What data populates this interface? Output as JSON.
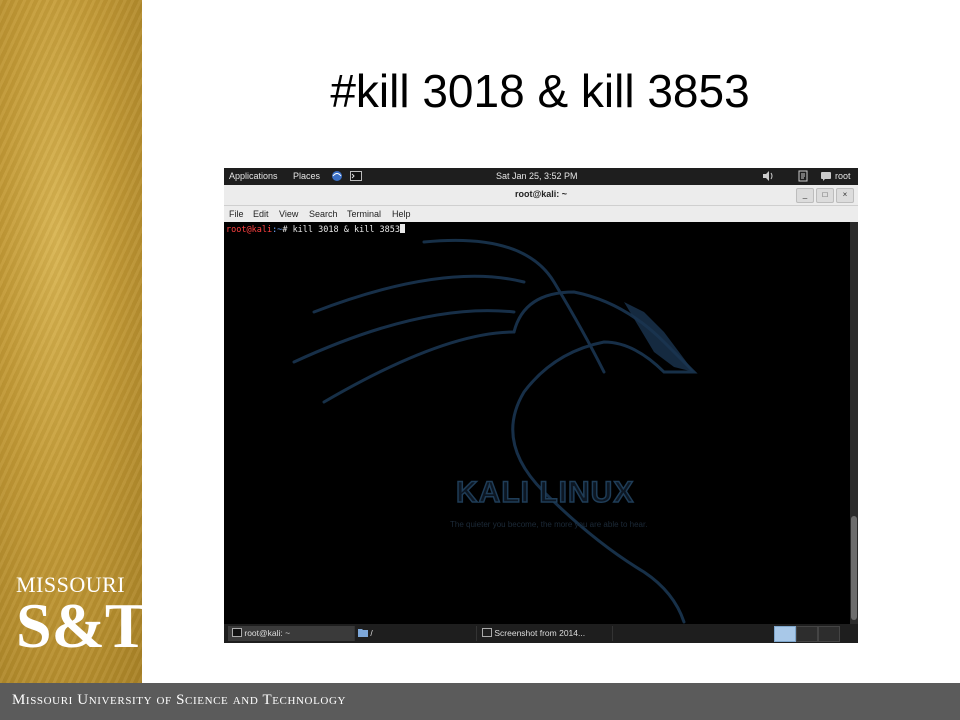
{
  "slide": {
    "title": "#kill 3018 & kill 3853",
    "footer": "Missouri University of Science and Technology",
    "logo": {
      "top": "MISSOURI",
      "bottom": "S&T"
    }
  },
  "desktop": {
    "topbar": {
      "applications": "Applications",
      "places": "Places",
      "datetime": "Sat Jan 25,  3:52 PM",
      "user": "root"
    },
    "window": {
      "title": "root@kali: ~",
      "menu": [
        "File",
        "Edit",
        "View",
        "Search",
        "Terminal",
        "Help"
      ]
    },
    "terminal": {
      "prompt_user": "root@kali",
      "prompt_path": ":~",
      "prompt_symbol": "# ",
      "command": "kill 3018 & kill 3853"
    },
    "wallpaper": {
      "logo_text": "KALI LINUX",
      "tagline": "The quieter you become, the more you are able to hear."
    },
    "taskbar": {
      "items": [
        "root@kali: ~",
        "/",
        "Screenshot from 2014..."
      ]
    }
  }
}
